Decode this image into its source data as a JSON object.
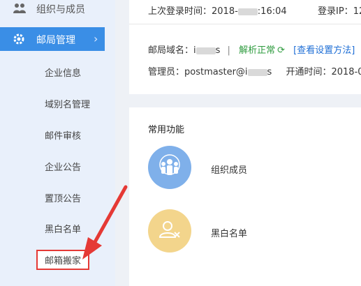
{
  "sidebar": {
    "top_item": {
      "label": "组织与成员",
      "icon": "users-icon"
    },
    "active_item": {
      "label": "邮局管理",
      "icon": "gear-icon"
    },
    "sub_items": [
      {
        "label": "企业信息"
      },
      {
        "label": "域别名管理"
      },
      {
        "label": "邮件审核"
      },
      {
        "label": "企业公告"
      },
      {
        "label": "置顶公告"
      },
      {
        "label": "黑白名单"
      },
      {
        "label": "邮箱搬家"
      }
    ]
  },
  "info": {
    "last_login_label": "上次登录时间：",
    "last_login_value_start": "2018-",
    "last_login_value_end": ":16:04",
    "login_ip_label": "登录IP：",
    "login_ip_value": "12",
    "domain_label": "邮局域名：i",
    "domain_suffix": "s",
    "separator": "|",
    "status": "解析正常",
    "view_settings": "[查看设置方法]",
    "admin_label": "管理员：",
    "admin_value_start": "postmaster@i",
    "admin_value_end": "s",
    "open_time_label": "开通时间：",
    "open_time_value": "2018-0"
  },
  "features": {
    "title": "常用功能",
    "items": [
      {
        "label": "组织成员",
        "icon": "team-icon",
        "color": "#7fb0ea"
      },
      {
        "label": "黑白名单",
        "icon": "user-block-icon",
        "color": "#f3d58c"
      }
    ]
  },
  "colors": {
    "accent": "#3a8ee6",
    "highlight_border": "#e53935",
    "status_green": "#2e9b3e",
    "link_blue": "#1f6fd6"
  }
}
